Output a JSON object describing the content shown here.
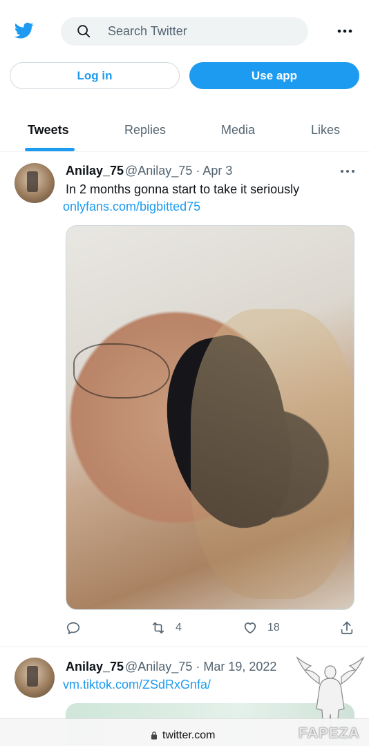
{
  "header": {
    "brand_color": "#1d9bf0",
    "search_placeholder": "Search Twitter",
    "icons": [
      "twitter-bird-icon",
      "search-icon",
      "more-icon"
    ]
  },
  "auth": {
    "login_label": "Log in",
    "use_app_label": "Use app"
  },
  "tabs": [
    {
      "label": "Tweets",
      "active": true
    },
    {
      "label": "Replies",
      "active": false
    },
    {
      "label": "Media",
      "active": false
    },
    {
      "label": "Likes",
      "active": false
    }
  ],
  "tweets": [
    {
      "name": "Anilay_75",
      "meta": "@Anilay_75 · Apr 3",
      "text": "In 2 months gonna start to take it seriously",
      "link": "onlyfans.com/bigbitted75",
      "has_media": true,
      "retweets": "4",
      "likes": "18"
    },
    {
      "name": "Anilay_75",
      "meta": "@Anilay_75 · Mar 19, 2022",
      "link": "vm.tiktok.com/ZSdRxGnfa/",
      "has_media": true
    }
  ],
  "browser": {
    "url": "twitter.com"
  },
  "watermark": {
    "text": "FAPEZA"
  }
}
